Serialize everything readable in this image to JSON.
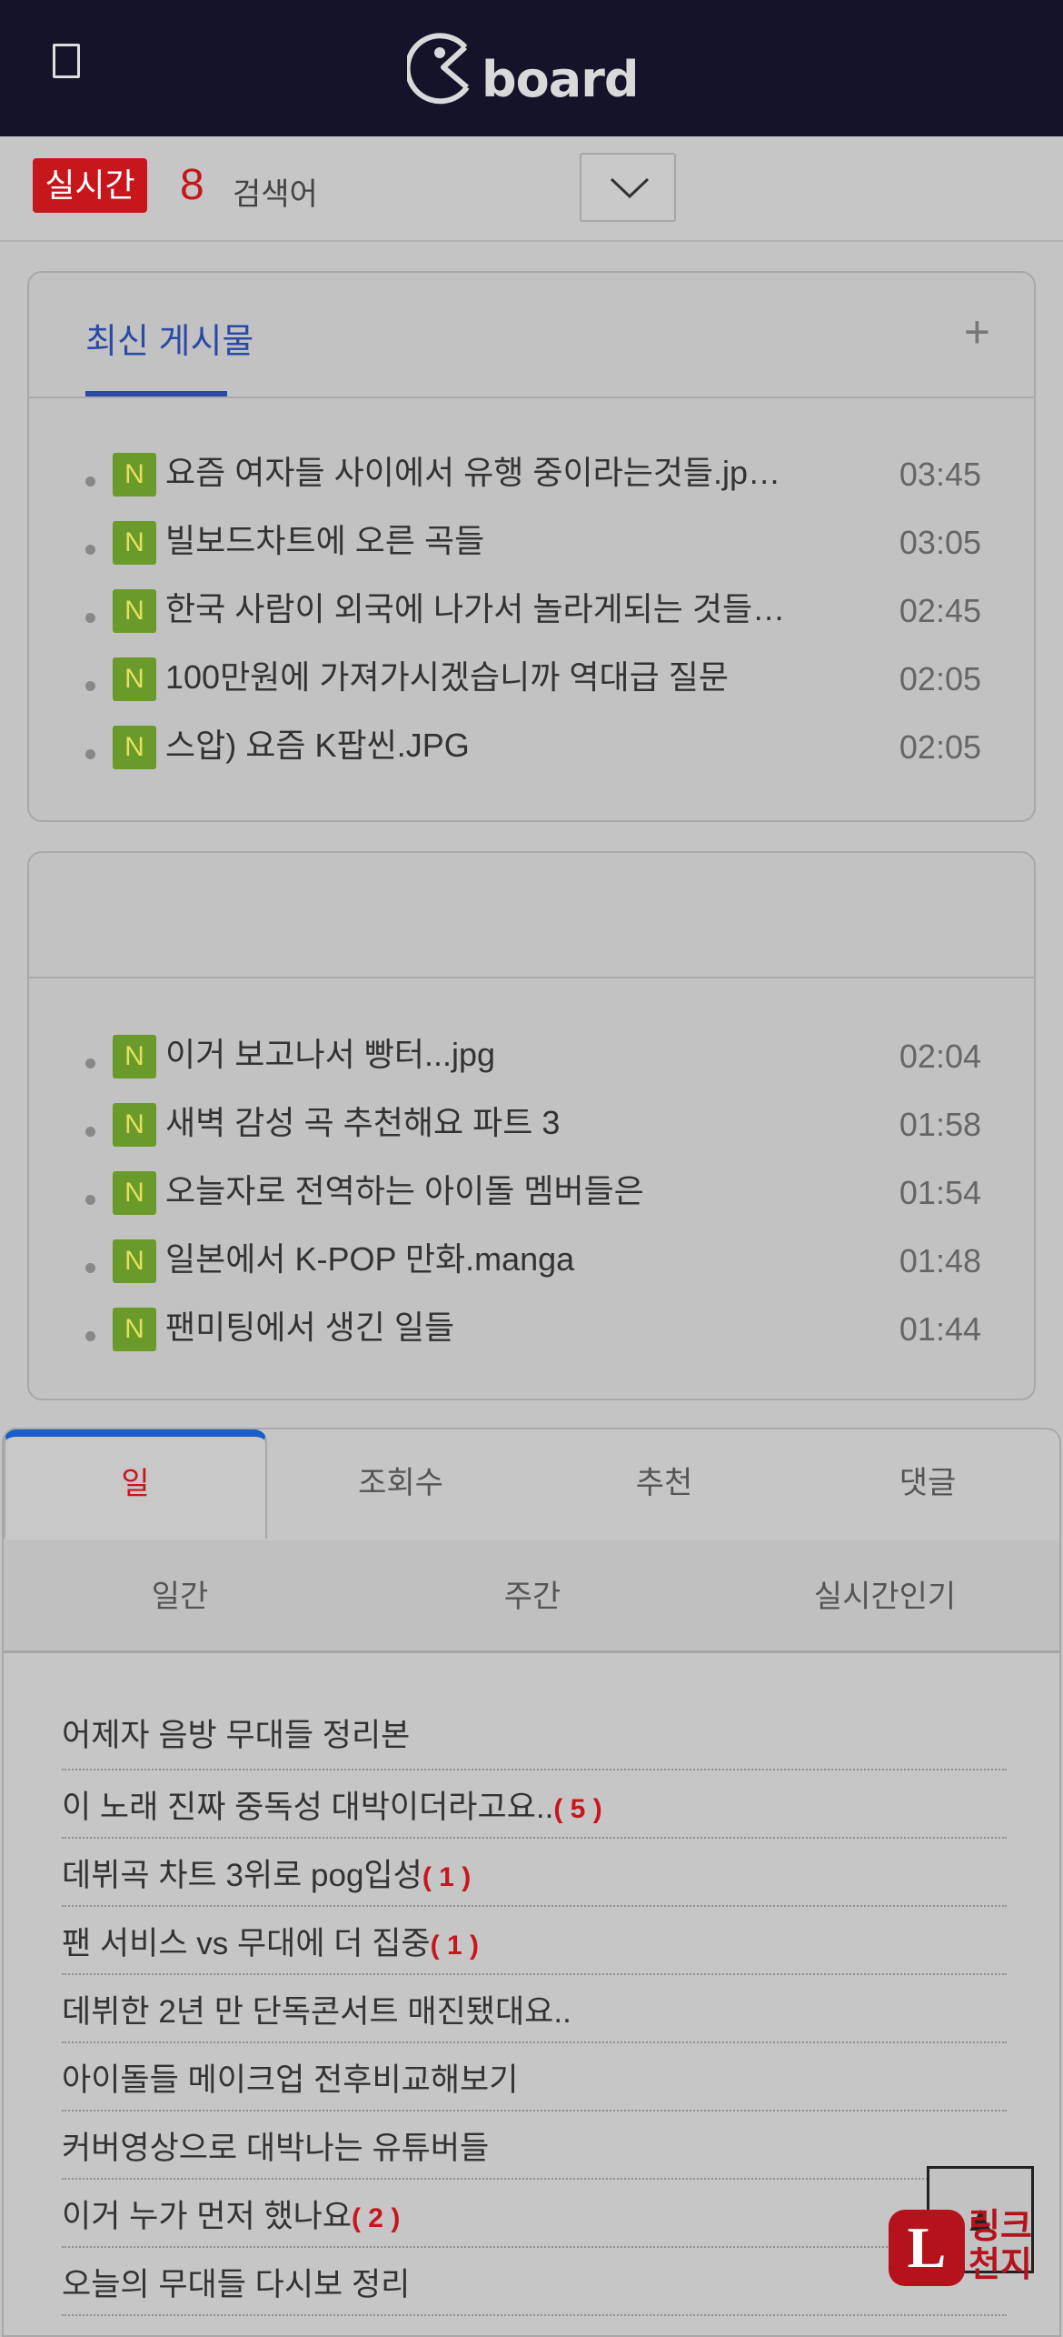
{
  "header": {
    "logo_text": "board",
    "menu_icon": "menu-icon"
  },
  "rank": {
    "badge": "실시간",
    "number": "8",
    "word": "검색어",
    "dropdown_icon": "chevron-down-icon"
  },
  "card1": {
    "tab_label": "최신 게시물",
    "plus": "+",
    "posts": [
      {
        "badge": "N",
        "title": "요즘 여자들 사이에서 유행 중이라는것들.jp…",
        "time": "03:45"
      },
      {
        "badge": "N",
        "title": "빌보드차트에 오른 곡들",
        "time": "03:05"
      },
      {
        "badge": "N",
        "title": "한국 사람이 외국에 나가서 놀라게되는 것들…",
        "time": "02:45"
      },
      {
        "badge": "N",
        "title": "100만원에 가져가시겠습니까 역대급 질문",
        "time": "02:05"
      },
      {
        "badge": "N",
        "title": "스압) 요즘 K팝씬.JPG",
        "time": "02:05"
      }
    ]
  },
  "card2": {
    "posts": [
      {
        "badge": "N",
        "title": "이거 보고나서 빵터...jpg",
        "time": "02:04"
      },
      {
        "badge": "N",
        "title": "새벽 감성 곡 추천해요 파트 3",
        "time": "01:58"
      },
      {
        "badge": "N",
        "title": "오늘자로 전역하는 아이돌 멤버들은",
        "time": "01:54"
      },
      {
        "badge": "N",
        "title": "일본에서 K-POP 만화.manga",
        "time": "01:48"
      },
      {
        "badge": "N",
        "title": "팬미팅에서 생긴 일들",
        "time": "01:44"
      }
    ]
  },
  "bottom": {
    "tabs": [
      "일",
      "조회수",
      "추천",
      "댓글"
    ],
    "subtabs": [
      "일간",
      "주간",
      "실시간인기"
    ],
    "best": [
      {
        "title": "어제자 음방 무대들 정리본",
        "comments": ""
      },
      {
        "title": "이 노래 진짜 중독성 대박이더라고요..",
        "comments": "( 5 )"
      },
      {
        "title": "데뷔곡 차트 3위로 pog입성",
        "comments": "( 1 )"
      },
      {
        "title": "팬 서비스 vs 무대에 더 집중",
        "comments": "( 1 )"
      },
      {
        "title": "데뷔한 2년 만 단독콘서트 매진됐대요..",
        "comments": ""
      },
      {
        "title": "아이돌들 메이크업 전후비교해보기",
        "comments": ""
      },
      {
        "title": "커버영상으로 대박나는 유튜버들",
        "comments": ""
      },
      {
        "title": "이거 누가 먼저 했나요",
        "comments": "( 2 )"
      },
      {
        "title": "오늘의 무대들 다시보 정리",
        "comments": ""
      }
    ]
  },
  "top_button": "▲",
  "ad": {
    "letter": "L",
    "text_line1": "링크",
    "text_line2": "천지"
  }
}
